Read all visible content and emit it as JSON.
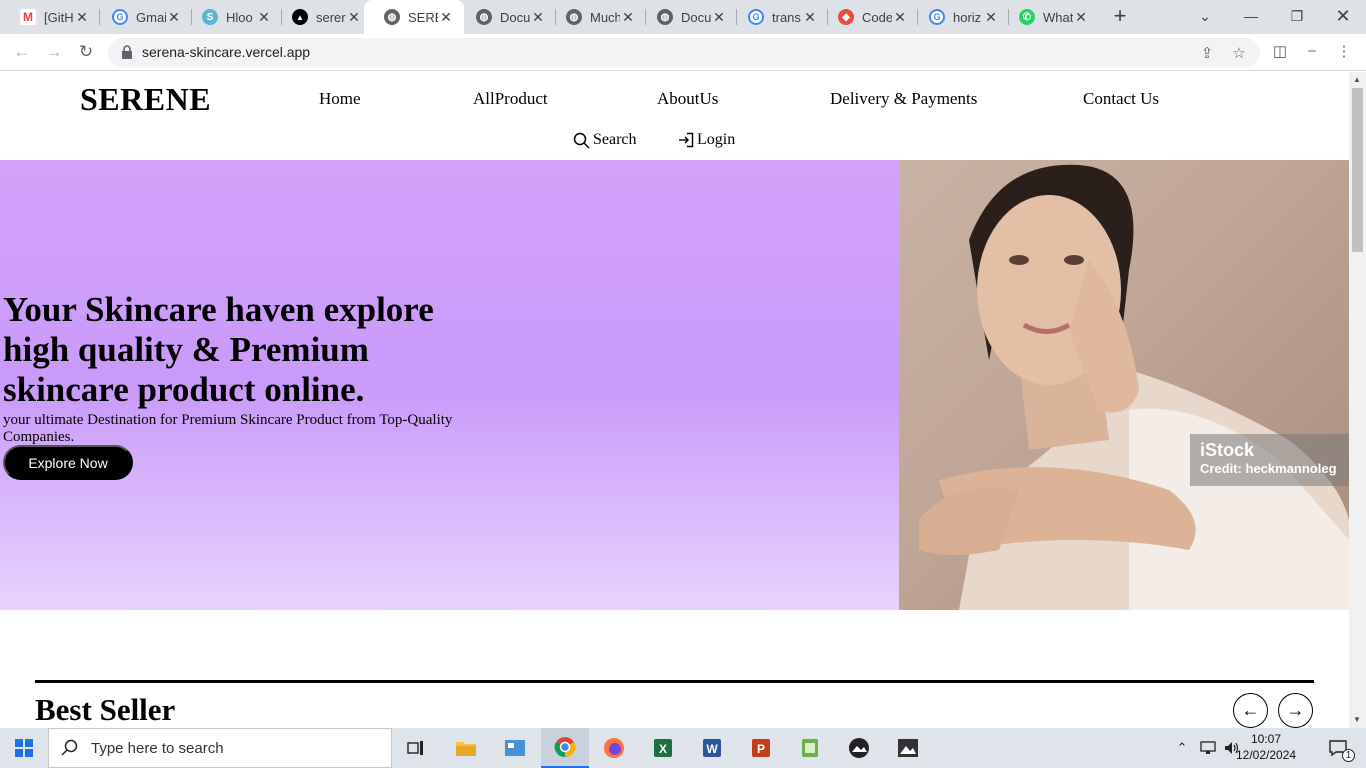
{
  "browser": {
    "tabs": [
      {
        "title": "[GitH",
        "icon": "gmail-icon"
      },
      {
        "title": "Gmai",
        "icon": "google-icon"
      },
      {
        "title": "Hloo",
        "icon": "app-icon"
      },
      {
        "title": "serer",
        "icon": "vercel-icon"
      },
      {
        "title": "SERE",
        "icon": "globe-icon"
      },
      {
        "title": "Docu",
        "icon": "globe-icon"
      },
      {
        "title": "Much",
        "icon": "globe-icon"
      },
      {
        "title": "Docu",
        "icon": "globe-icon"
      },
      {
        "title": "trans",
        "icon": "google-icon"
      },
      {
        "title": "Code",
        "icon": "codepen-icon"
      },
      {
        "title": "horiz",
        "icon": "google-icon"
      },
      {
        "title": "What",
        "icon": "whatsapp-icon"
      }
    ],
    "active_tab": 4,
    "url": "serena-skincare.vercel.app"
  },
  "site": {
    "logo": "SERENE",
    "nav": [
      "Home",
      "AllProduct",
      "AboutUs",
      "Delivery & Payments",
      "Contact Us"
    ],
    "search_label": "Search",
    "login_label": "Login"
  },
  "hero": {
    "heading": "Your Skincare haven explore high quality & Premium skincare product online.",
    "subtext": "your ultimate Destination for Premium Skincare Product from Top-Quality Companies.",
    "cta": "Explore Now",
    "watermark_brand": "iStock",
    "watermark_credit": "Credit: heckmannoleg"
  },
  "best_seller": {
    "title": "Best Seller"
  },
  "taskbar": {
    "search_placeholder": "Type here to search",
    "time": "10:07",
    "date": "12/02/2024",
    "notifications": "1"
  },
  "colors": {
    "hero_top": "#d3a3fb",
    "hero_bottom": "#e8d3fd",
    "cta_bg": "#000000"
  }
}
